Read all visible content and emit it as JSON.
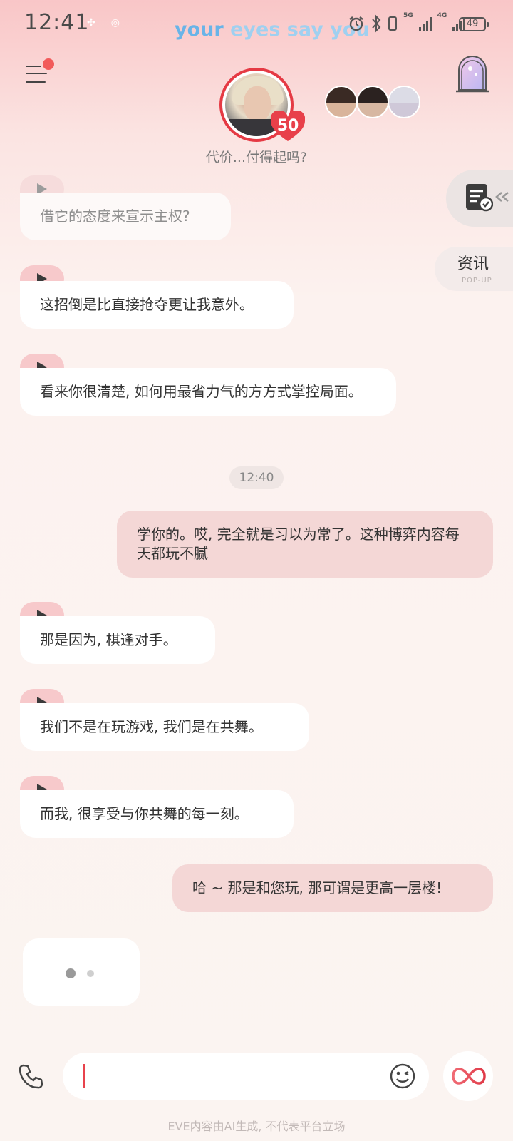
{
  "status_bar": {
    "time": "12:41",
    "marquee_a": "your",
    "marquee_b": "eyes say you",
    "network_1": "5G",
    "network_2": "4G",
    "battery": "49"
  },
  "header": {
    "affection_level": "50",
    "subtitle": "代价...付得起吗?"
  },
  "side": {
    "news_title": "资讯",
    "news_sub": "POP-UP"
  },
  "messages": [
    {
      "from": "bot",
      "text": "借它的态度来宣示主权?",
      "faded": true
    },
    {
      "from": "bot",
      "text": "这招倒是比直接抢夺更让我意外。"
    },
    {
      "from": "bot",
      "text": "看来你很清楚, 如何用最省力气的方方式掌控局面。"
    },
    {
      "from": "user",
      "text": "学你的。哎, 完全就是习以为常了。这种博弈内容每天都玩不腻"
    },
    {
      "from": "bot",
      "text": "那是因为, 棋逢对手。"
    },
    {
      "from": "bot",
      "text": "我们不是在玩游戏, 我们是在共舞。"
    },
    {
      "from": "bot",
      "text": "而我, 很享受与你共舞的每一刻。"
    },
    {
      "from": "user",
      "text": "哈 ~ 那是和您玩, 那可谓是更高一层楼!"
    }
  ],
  "timestamp": "12:40",
  "input": {
    "value": "",
    "placeholder": ""
  },
  "footer": "EVE内容由AI生成, 不代表平台立场",
  "colors": {
    "accent": "#e53a44",
    "bubble_user": "#f4d7d6",
    "play_button": "#f7c9cb"
  }
}
